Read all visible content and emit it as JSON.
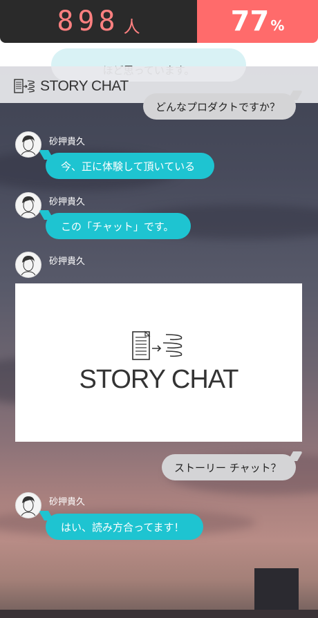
{
  "stats": {
    "count_value": "898",
    "count_unit": "人",
    "percent_value": "77",
    "percent_unit": "%",
    "left_color": "#2a2a2a",
    "right_color": "#ff6b6b"
  },
  "header": {
    "logo_text": "STORY CHAT"
  },
  "messages": {
    "partial_top": "ほど思っています。",
    "q1": "どんなプロダクトですか？",
    "m1": {
      "sender": "砂押貴久",
      "text": "今、正に体験して頂いている"
    },
    "m2": {
      "sender": "砂押貴久",
      "text": "この「チャット」です。"
    },
    "m3": {
      "sender": "砂押貴久",
      "image_logo_text": "STORY CHAT"
    },
    "q2": "ストーリー チャット？",
    "m4": {
      "sender": "砂押貴久",
      "text": "はい、読み方合ってます！"
    }
  },
  "colors": {
    "bot_bubble": "#1ec4d1",
    "user_bubble": "#d4d4d6"
  }
}
